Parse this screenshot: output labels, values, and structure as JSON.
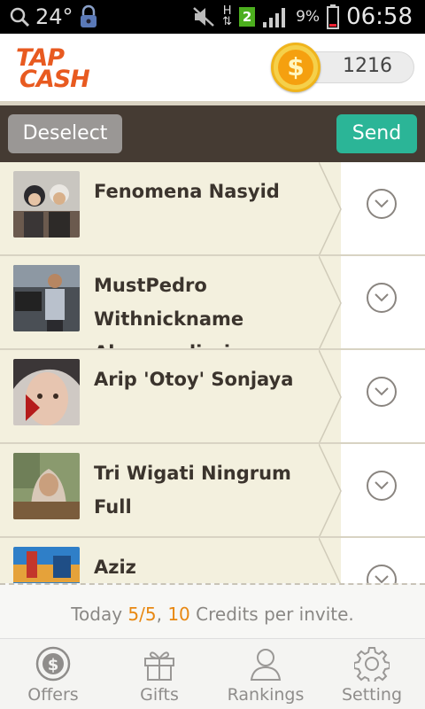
{
  "status_bar": {
    "temperature": "24°",
    "sim_badge": "2",
    "network": "H",
    "battery": "9%",
    "time": "06:58"
  },
  "header": {
    "logo_line1": "TAP",
    "logo_line2": "CASH",
    "coin_symbol": "$",
    "credits": "1216"
  },
  "actions": {
    "deselect_label": "Deselect",
    "send_label": "Send"
  },
  "contacts": [
    {
      "name": "Fenomena Nasyid"
    },
    {
      "name": "MustPedro Withnickname Akoosandiario"
    },
    {
      "name": "Arip 'Otoy' Sonjaya"
    },
    {
      "name": "Tri Wigati Ningrum Full"
    },
    {
      "name": "Aziz"
    }
  ],
  "footer": {
    "prefix": "Today ",
    "used": "5/5",
    "sep": ", ",
    "credits": "10",
    "suffix": " Credits per invite."
  },
  "tabs": [
    {
      "label": "Offers",
      "icon": "dollar-coin-icon"
    },
    {
      "label": "Gifts",
      "icon": "gift-icon"
    },
    {
      "label": "Rankings",
      "icon": "person-icon"
    },
    {
      "label": "Setting",
      "icon": "gear-icon"
    }
  ],
  "colors": {
    "accent_send": "#2bb597",
    "logo": "#e85a20",
    "highlight": "#e88812",
    "action_bar": "#453b33"
  }
}
